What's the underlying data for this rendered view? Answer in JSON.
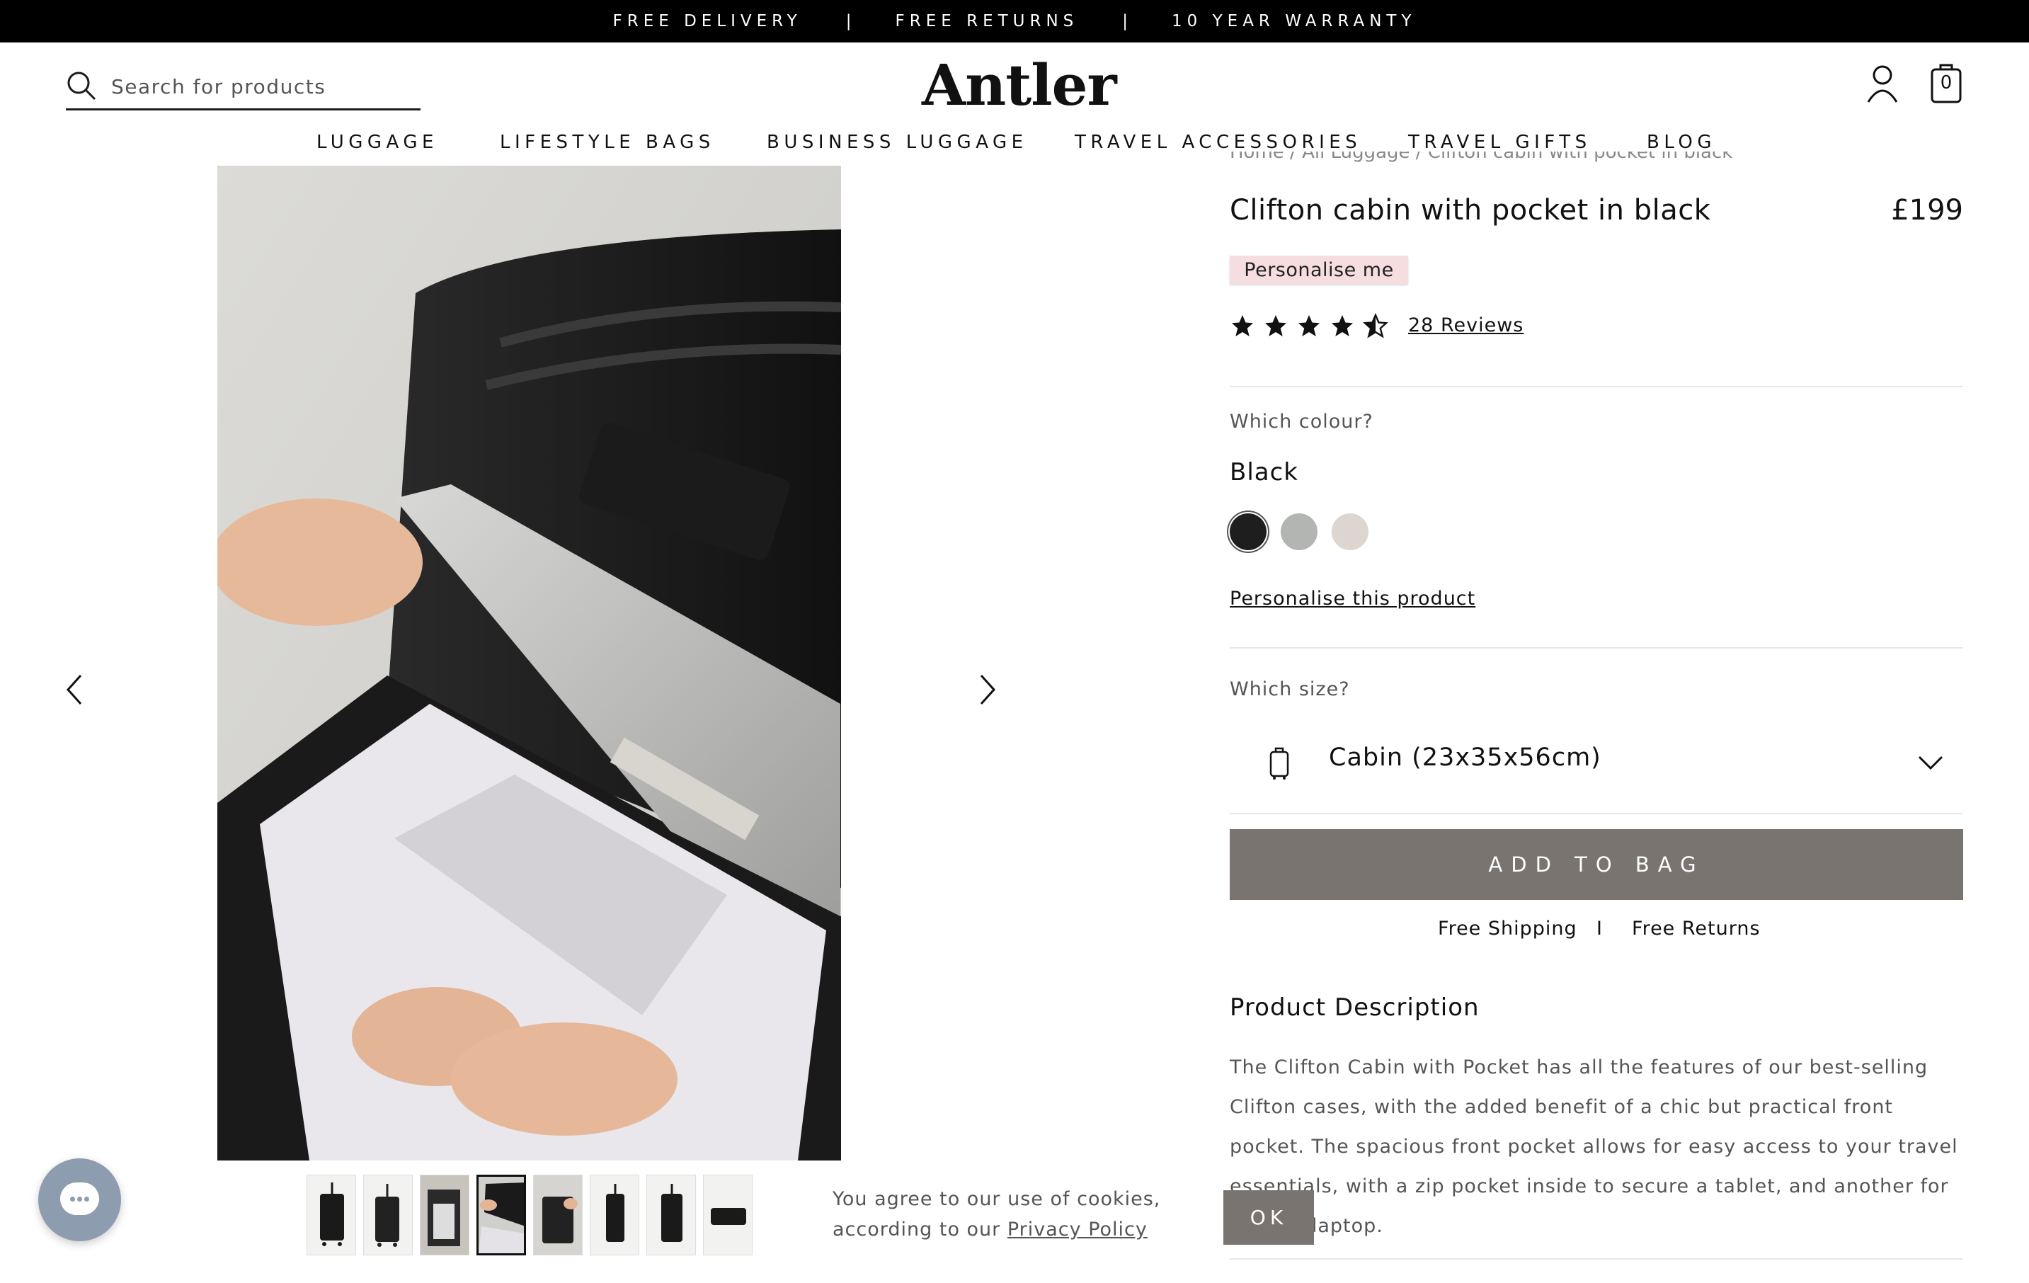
{
  "announcement": {
    "items": [
      "FREE DELIVERY",
      "FREE RETURNS",
      "10 YEAR WARRANTY"
    ],
    "separator": "|"
  },
  "header": {
    "search_placeholder": "Search for products",
    "logo": "Antler",
    "bag_count": "0"
  },
  "nav": {
    "items": [
      "LUGGAGE",
      "LIFESTYLE BAGS",
      "BUSINESS LUGGAGE",
      "TRAVEL ACCESSORIES",
      "TRAVEL GIFTS",
      "BLOG"
    ]
  },
  "breadcrumb": "Home  /  All Luggage  /  Clifton cabin with pocket in black",
  "product": {
    "title": "Clifton cabin with pocket in black",
    "price": "£199",
    "badge": "Personalise me",
    "rating": 4.5,
    "reviews_label": "28 Reviews",
    "colour_label": "Which colour?",
    "colour_selected": "Black",
    "swatches": [
      "#1e1e1e",
      "#b3b5b2",
      "#ddd5d0"
    ],
    "personalise_link": "Personalise this product",
    "size_label": "Which size?",
    "size_selected": "Cabin (23x35x56cm)",
    "add_to_bag": "ADD TO BAG",
    "shipping": "Free Shipping",
    "shipping_sep": "I",
    "returns": "Free Returns",
    "description_heading": "Product Description",
    "description": "The Clifton Cabin with Pocket has all the features of our best-selling Clifton cases, with the added benefit of a chic but practical front pocket. The spacious front pocket allows for easy access to your travel essentials, with a zip pocket inside to secure a tablet, and another for a 15.6” laptop."
  },
  "gallery": {
    "thumbnail_count": 8,
    "active_index": 3
  },
  "cookie": {
    "text": "You agree to our use of cookies, according to our",
    "link": "Privacy Policy",
    "ok": "OK"
  },
  "colors": {
    "accent_button": "#797470",
    "badge_bg": "#f6dde0",
    "chat": "#8e9cb0"
  }
}
